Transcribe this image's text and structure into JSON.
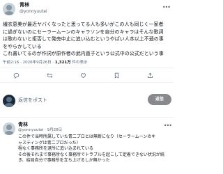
{
  "main_tweet": {
    "display_name": "青林",
    "handle": "@yonnyuutei",
    "more_icon": "more-dots-icon",
    "body_lines": [
      "繊衣恵美が最近ヤバくなったと思ってる人も多いがこの人も同じく一家者",
      "に過ぎないのにセーラームーンのキャラソンを自分のキャラはそんな歌詞",
      "は歌わないと拒否して発売中止に追い込むというやばい人本以上不遜の事",
      "をやらかしている",
      "これ書いてるのが作詞が原作者の武内直子という公式中の公式だという事"
    ],
    "meta": {
      "time": "午前2:16",
      "date": "2026年9月26日",
      "views_count": "1,321万",
      "views_label": "件の表示"
    },
    "actions": {
      "reply_icon": "reply-icon",
      "retweet_icon": "retweet-icon",
      "like_icon": "like-icon",
      "bookmark_icon": "bookmark-icon",
      "share_icon": "share-icon"
    }
  },
  "composer": {
    "placeholder": "返信をポスト",
    "reply_button_label": "返信"
  },
  "reply_tweet": {
    "display_name": "青林",
    "handle": "@yonnyuutei",
    "date": "9月26日",
    "more_icon": "more-dots-icon",
    "body_lines": [
      "この件で当時所属していた青二プロとは無断になり（セーラームーンのキ",
      "ャスティングは青二プロだった）",
      "程なく事務所を退所に追い込まれている",
      "その後それまで事務所なく事務所でトラブルを起こして定着できない状況が続",
      "き、結局自分で事務所を立ち上げるしか無かった"
    ]
  },
  "colors": {
    "text": "#0f1419",
    "secondary": "#536471",
    "divider": "#eff3f4",
    "reply_button_bg": "#87898c"
  }
}
